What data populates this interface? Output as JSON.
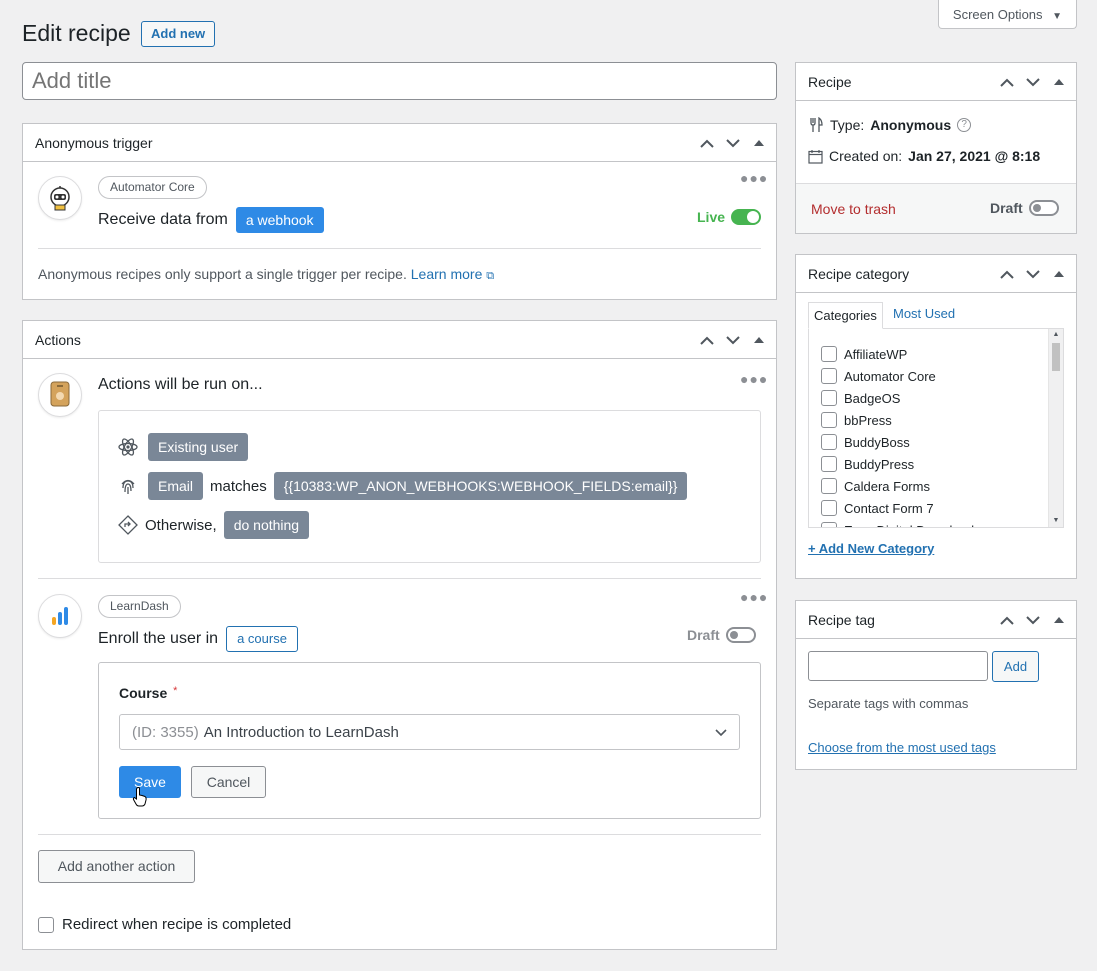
{
  "header": {
    "title": "Edit recipe",
    "add_new": "Add new",
    "screen_options": "Screen Options",
    "title_placeholder": "Add title"
  },
  "trigger_box": {
    "title": "Anonymous trigger",
    "integration": "Automator Core",
    "sentence": "Receive data from",
    "token": "a webhook",
    "status": "Live",
    "note": "Anonymous recipes only support a single trigger per recipe.",
    "learn_more": "Learn more"
  },
  "actions_box": {
    "title": "Actions",
    "run_on": "Actions will be run on...",
    "existing_user": "Existing user",
    "email_label": "Email",
    "matches": "matches",
    "email_token": "{{10383:WP_ANON_WEBHOOKS:WEBHOOK_FIELDS:email}}",
    "otherwise": "Otherwise,",
    "do_nothing": "do nothing",
    "action": {
      "integration": "LearnDash",
      "sentence": "Enroll the user in",
      "token": "a course",
      "status": "Draft",
      "field_label": "Course",
      "required_mark": "*",
      "select_id": "(ID: 3355)",
      "select_value": "An Introduction to LearnDash",
      "save": "Save",
      "cancel": "Cancel"
    },
    "add_another": "Add another action",
    "redirect_label": "Redirect when recipe is completed"
  },
  "recipe_box": {
    "title": "Recipe",
    "type_label": "Type:",
    "type_value": "Anonymous",
    "created_label": "Created on:",
    "created_value": "Jan 27, 2021 @ 8:18",
    "trash": "Move to trash",
    "status": "Draft"
  },
  "category_box": {
    "title": "Recipe category",
    "tab_categories": "Categories",
    "tab_most_used": "Most Used",
    "items": [
      "AffiliateWP",
      "Automator Core",
      "BadgeOS",
      "bbPress",
      "BuddyBoss",
      "BuddyPress",
      "Caldera Forms",
      "Contact Form 7",
      "Easy Digital Downloads"
    ],
    "add_new": "+ Add New Category"
  },
  "tag_box": {
    "title": "Recipe tag",
    "add": "Add",
    "hint": "Separate tags with commas",
    "choose": "Choose from the most used tags"
  },
  "colors": {
    "accent": "#2271b1",
    "live": "#46b450",
    "trash": "#b32d2e"
  }
}
